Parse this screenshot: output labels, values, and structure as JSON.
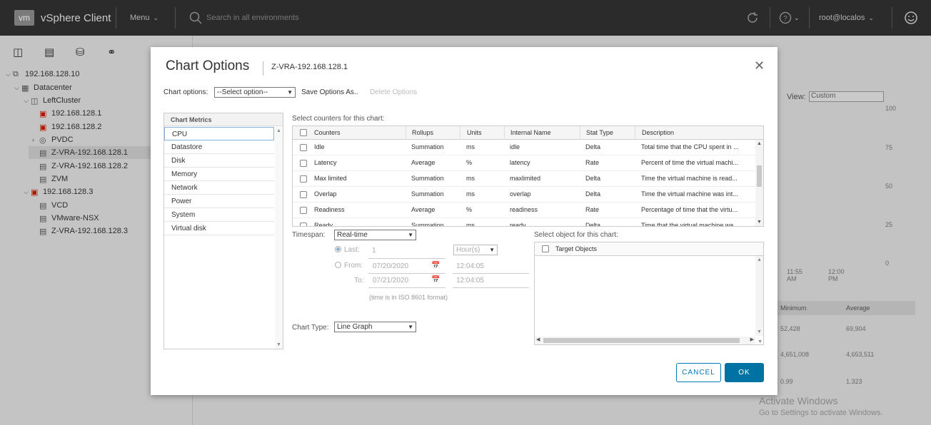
{
  "header": {
    "logo": "vm",
    "app_name": "vSphere Client",
    "menu_label": "Menu",
    "search_placeholder": "Search in all environments",
    "user": "root@localos"
  },
  "nav_icons": [
    "hosts-clusters-icon",
    "vms-templates-icon",
    "storage-icon",
    "networking-icon"
  ],
  "tree": [
    {
      "label": "192.168.128.10",
      "icon": "vcenter-icon",
      "twisty": "v"
    },
    {
      "label": "Datacenter",
      "icon": "datacenter-icon",
      "twisty": "v"
    },
    {
      "label": "LeftCluster",
      "icon": "cluster-icon",
      "twisty": "v"
    },
    {
      "label": "192.168.128.1",
      "icon": "host-alert-icon",
      "twisty": ""
    },
    {
      "label": "192.168.128.2",
      "icon": "host-alert-icon",
      "twisty": ""
    },
    {
      "label": "PVDC",
      "icon": "resource-pool-icon",
      "twisty": ">"
    },
    {
      "label": "Z-VRA-192.168.128.1",
      "icon": "vm-icon",
      "twisty": ""
    },
    {
      "label": "Z-VRA-192.168.128.2",
      "icon": "vm-icon",
      "twisty": ""
    },
    {
      "label": "ZVM",
      "icon": "vm-icon",
      "twisty": ""
    },
    {
      "label": "192.168.128.3",
      "icon": "host-alert-icon",
      "twisty": "v"
    },
    {
      "label": "VCD",
      "icon": "vm-icon",
      "twisty": ""
    },
    {
      "label": "VMware-NSX",
      "icon": "vm-icon",
      "twisty": ""
    },
    {
      "label": "Z-VRA-192.168.128.3",
      "icon": "vm-icon",
      "twisty": ""
    }
  ],
  "background": {
    "view_label": "View:",
    "view_value": "Custom",
    "y_ticks": [
      "100",
      "75",
      "50",
      "25",
      "0"
    ],
    "x_ticks": [
      "11:55 AM",
      "12:00 PM"
    ],
    "table_headers": [
      "Minimum",
      "Average"
    ],
    "table_rows": [
      [
        "52,428",
        "69,904"
      ],
      [
        "4,651,008",
        "4,653,511"
      ],
      [
        "0.99",
        "1.323"
      ]
    ],
    "watermark_title": "Activate Windows",
    "watermark_sub": "Go to Settings to activate Windows."
  },
  "modal": {
    "title": "Chart Options",
    "subtitle": "Z-VRA-192.168.128.1",
    "chart_options_label": "Chart options:",
    "chart_options_value": "--Select option--",
    "save_options": "Save Options As..",
    "delete_options": "Delete Options",
    "metrics_header": "Chart Metrics",
    "metrics": [
      "CPU",
      "Datastore",
      "Disk",
      "Memory",
      "Network",
      "Power",
      "System",
      "Virtual disk"
    ],
    "selected_metric": "CPU",
    "counters_label": "Select counters for this chart:",
    "counter_columns": [
      "Counters",
      "Rollups",
      "Units",
      "Internal Name",
      "Stat Type",
      "Description"
    ],
    "counters": [
      [
        "Idle",
        "Summation",
        "ms",
        "idle",
        "Delta",
        "Total time that the CPU spent in ..."
      ],
      [
        "Latency",
        "Average",
        "%",
        "latency",
        "Rate",
        "Percent of time the virtual machi..."
      ],
      [
        "Max limited",
        "Summation",
        "ms",
        "maxlimited",
        "Delta",
        "Time the virtual machine is read..."
      ],
      [
        "Overlap",
        "Summation",
        "ms",
        "overlap",
        "Delta",
        "Time the virtual machine was int..."
      ],
      [
        "Readiness",
        "Average",
        "%",
        "readiness",
        "Rate",
        "Percentage of time that the virtu..."
      ],
      [
        "Ready",
        "Summation",
        "ms",
        "ready",
        "Delta",
        "Time that the virtual machine wa..."
      ]
    ],
    "timespan_label": "Timespan:",
    "timespan_value": "Real-time",
    "last_label": "Last:",
    "last_value": "1",
    "last_unit": "Hour(s)",
    "from_label": "From:",
    "from_date": "07/20/2020",
    "from_time": "12:04:05",
    "to_label": "To:",
    "to_date": "07/21/2020",
    "to_time": "12:04:05",
    "iso_note": "(time is in ISO 8601 format)",
    "chart_type_label": "Chart Type:",
    "chart_type_value": "Line Graph",
    "objects_label": "Select object for this chart:",
    "objects_header": "Target Objects",
    "cancel": "CANCEL",
    "ok": "OK"
  }
}
